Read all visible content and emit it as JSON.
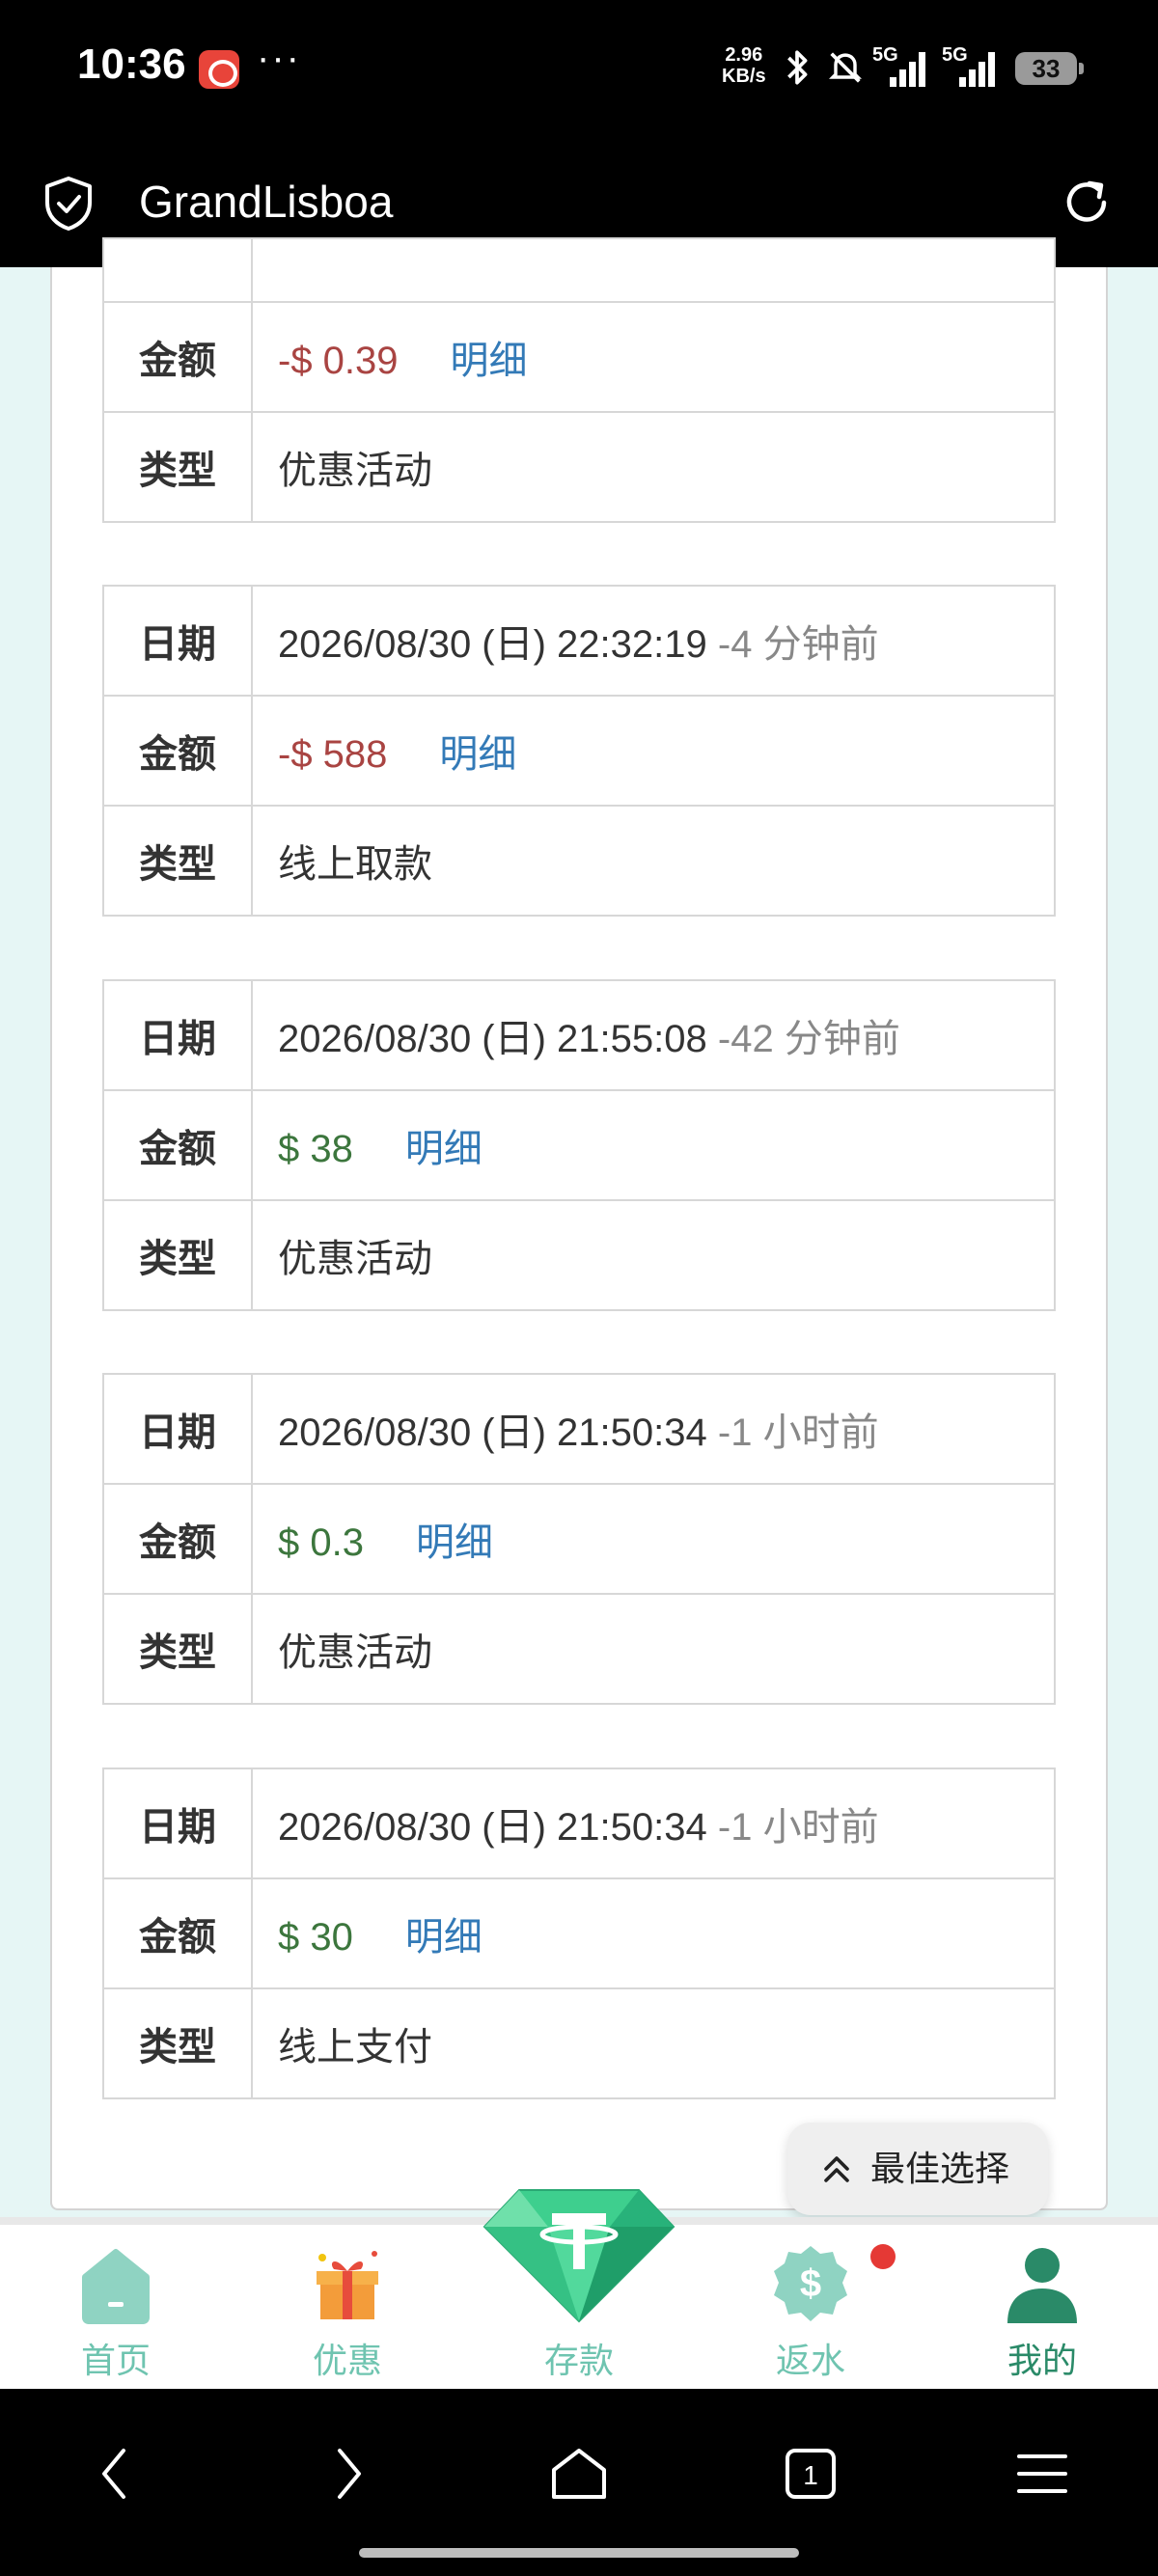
{
  "status_bar": {
    "time": "10:36",
    "more": "···",
    "net_speed_value": "2.96",
    "net_speed_unit": "KB/s",
    "signal1": "5G",
    "signal2": "5G",
    "battery": "33"
  },
  "browser": {
    "title": "GrandLisboa"
  },
  "labels": {
    "date": "日期",
    "amount": "金额",
    "type": "类型",
    "detail": "明细"
  },
  "records": [
    {
      "amount": "-$ 0.39",
      "type": "优惠活动"
    },
    {
      "date": "2026/08/30 (日) 22:32:19",
      "ago": "-4 分钟前",
      "amount": "-$ 588",
      "type": "线上取款"
    },
    {
      "date": "2026/08/30 (日) 21:55:08",
      "ago": "-42 分钟前",
      "amount": "$ 38",
      "type": "优惠活动"
    },
    {
      "date": "2026/08/30 (日) 21:50:34",
      "ago": "-1 小时前",
      "amount": "$ 0.3",
      "type": "优惠活动"
    },
    {
      "date": "2026/08/30 (日) 21:50:34",
      "ago": "-1 小时前",
      "amount": "$ 30",
      "type": "线上支付"
    }
  ],
  "best_choice": "最佳选择",
  "tabs": [
    {
      "label": "首页"
    },
    {
      "label": "优惠"
    },
    {
      "label": "存款"
    },
    {
      "label": "返水"
    },
    {
      "label": "我的"
    }
  ],
  "colors": {
    "negative": "#a94442",
    "positive": "#3c763d",
    "link": "#337ab7",
    "tab_inactive": "#6fc4b0",
    "tab_active": "#2a8a68"
  }
}
